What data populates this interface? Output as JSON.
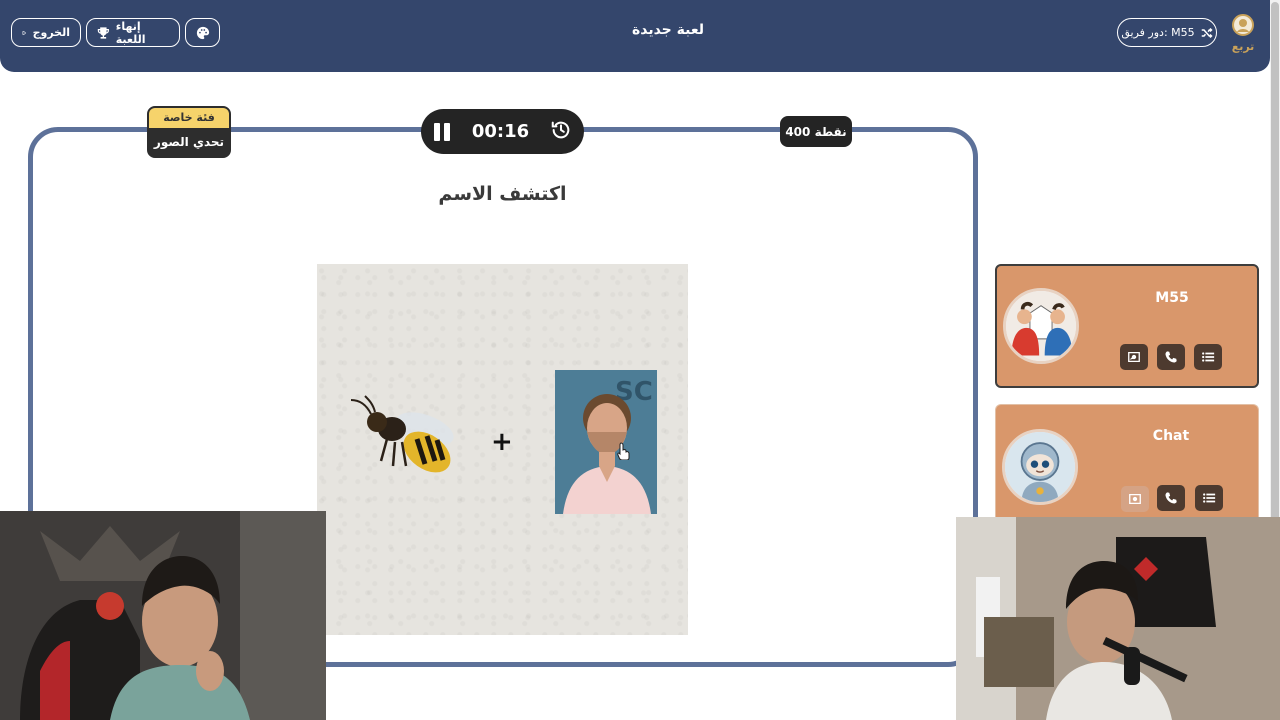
{
  "header": {
    "exit_label": "الخروج",
    "end_game_label": "إنهاء اللعبة",
    "title": "لعبة جديدة",
    "turn_label": "دور فريق: M55",
    "logo_text": "تربع"
  },
  "game": {
    "category_type": "فئة خاصة",
    "category_name": "تحدي الصور",
    "timer": "00:16",
    "points": "400 نقطة",
    "question": "اكتشف الاسم",
    "plus": "+"
  },
  "teams": [
    {
      "name": "M55",
      "active": true
    },
    {
      "name": "Chat",
      "active": false
    }
  ],
  "colors": {
    "header_bg": "#34466c",
    "frame_border": "#5d7199",
    "team_card_bg": "#d9976b",
    "category_highlight": "#f6d36b"
  },
  "icons": [
    "exit-icon",
    "trophy-icon",
    "palette-icon",
    "shuffle-icon",
    "pause-icon",
    "history-icon",
    "photo-icon",
    "phone-icon",
    "list-icon"
  ]
}
